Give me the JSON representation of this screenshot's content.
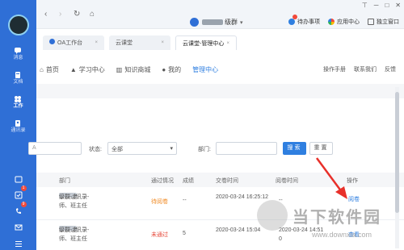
{
  "rail": {
    "items": [
      {
        "label": "消息",
        "icon": "chat-icon"
      },
      {
        "label": "文档",
        "icon": "document-icon"
      },
      {
        "label": "工作",
        "icon": "grid-icon"
      },
      {
        "label": "通讯录",
        "icon": "contacts-icon"
      }
    ],
    "bottom_badges": [
      "1",
      "9"
    ]
  },
  "titlebar": {
    "group_name": "级群",
    "todo": "待办事项",
    "apps": "应用中心",
    "standalone": "独立窗口"
  },
  "tabs": [
    {
      "label": "OA工作台"
    },
    {
      "label": "云课堂"
    },
    {
      "label": "云课堂-管理中心"
    }
  ],
  "sitenav": {
    "items": [
      "首页",
      "学习中心",
      "知识商城",
      "我的",
      "管理中心"
    ],
    "right": [
      "操作手册",
      "联系我们",
      "反馈"
    ]
  },
  "filter": {
    "name_placeholder": "A",
    "status_label": "状态:",
    "status_value": "全部",
    "dept_label": "部门:",
    "search": "搜索",
    "reset": "重置"
  },
  "table": {
    "headers": [
      "部门",
      "通过情况",
      "成绩",
      "交卷时间",
      "阅卷时间",
      "操作"
    ],
    "rows": [
      {
        "dept_prefix": "家校通讯录-",
        "dept_mid": "级群-老",
        "dept_suffix": "师、班主任",
        "status": "待阅卷",
        "score": "--",
        "submit_time": "2020-03-24 16:25:12",
        "read_time": "--",
        "op": "阅卷"
      },
      {
        "dept_prefix": "家校通讯录-",
        "dept_mid": "级群-老",
        "dept_suffix": "师、班主任",
        "status": "未通过",
        "score": "5",
        "submit_time": "2020-03-24 15:04",
        "read_time": "2020-03-24 14:51 0",
        "op": "查看"
      }
    ]
  },
  "watermark": {
    "name": "当下软件园",
    "url": "www.downxia.com"
  }
}
